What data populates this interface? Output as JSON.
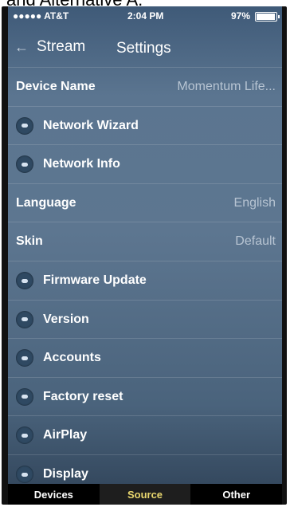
{
  "caption": "and Alternative A.",
  "status_bar": {
    "carrier": "●●●●● AT&T",
    "time": "2:04 PM",
    "battery": "97%",
    "battery_level": 0.97
  },
  "nav_bar": {
    "back_label": "Stream",
    "title": "Settings"
  },
  "settings": [
    {
      "type": "kv",
      "label": "Device Name",
      "value": "Momentum Life..."
    },
    {
      "type": "nav",
      "label": "Network Wizard"
    },
    {
      "type": "nav",
      "label": "Network Info"
    },
    {
      "type": "kv",
      "label": "Language",
      "value": "English"
    },
    {
      "type": "kv",
      "label": "Skin",
      "value": "Default"
    },
    {
      "type": "nav",
      "label": "Firmware Update"
    },
    {
      "type": "nav",
      "label": "Version"
    },
    {
      "type": "nav",
      "label": "Accounts"
    },
    {
      "type": "nav",
      "label": "Factory reset"
    },
    {
      "type": "nav",
      "label": "AirPlay"
    },
    {
      "type": "nav",
      "label": "Display"
    }
  ],
  "tab_bar": [
    {
      "label": "Devices",
      "active": false
    },
    {
      "label": "Source",
      "active": true
    },
    {
      "label": "Other",
      "active": false
    }
  ]
}
